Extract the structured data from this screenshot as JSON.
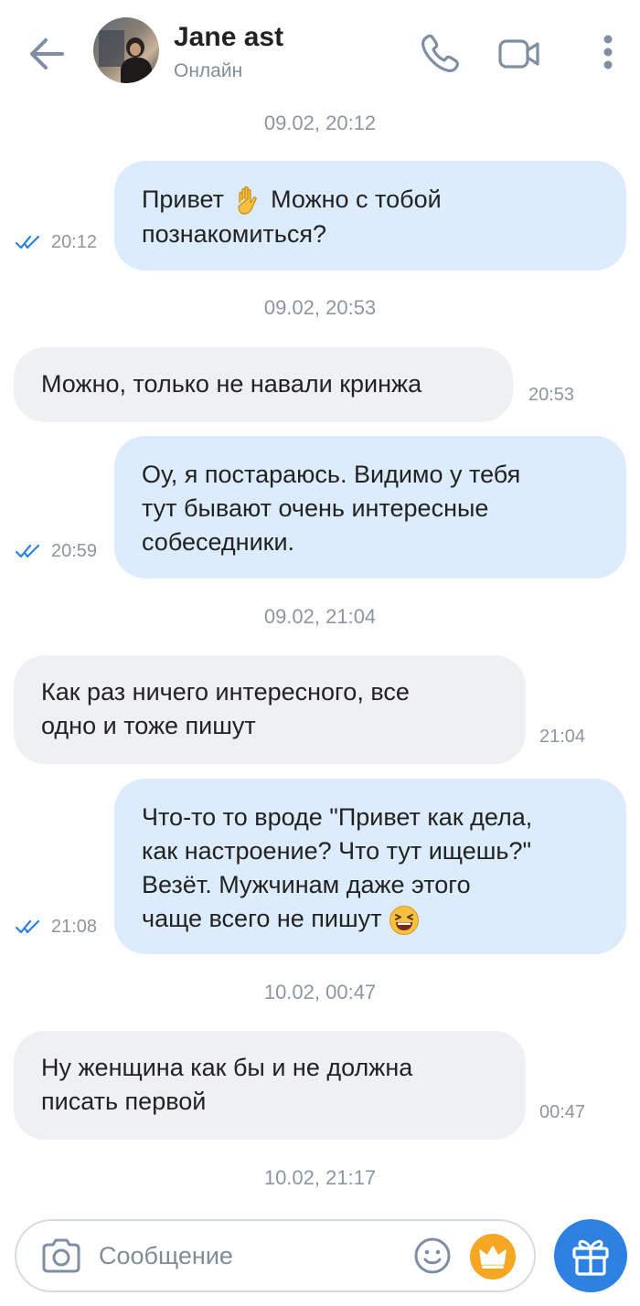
{
  "header": {
    "back_icon": "arrow-left-icon",
    "contact_name": "Jane ast",
    "status": "Онлайн",
    "call_icon": "phone-icon",
    "video_icon": "video-camera-icon",
    "menu_icon": "more-vertical-icon"
  },
  "dates": [
    "09.02, 20:12",
    "09.02, 20:53",
    "09.02, 21:04",
    "10.02, 00:47",
    "10.02, 21:17"
  ],
  "messages": [
    {
      "direction": "out",
      "text": "Привет",
      "text_after_emoji": "Можно с тобой",
      "text_line2": "познакомиться?",
      "emoji": "raised-hand",
      "time": "20:12",
      "read": true
    },
    {
      "direction": "in",
      "text": "Можно, только не навали кринжа",
      "time": "20:53"
    },
    {
      "direction": "out",
      "text": "Оу, я постараюсь. Видимо у тебя\nтут бывают очень интересные\nсобеседники.",
      "time": "20:59",
      "read": true
    },
    {
      "direction": "in",
      "text": "Как раз ничего интересного, все\nодно и тоже пишут",
      "time": "21:04"
    },
    {
      "direction": "out",
      "text": "Что-то то вроде \"Привет как дела,\nкак настроение? Что тут ищешь?\"\nВезёт. Мужчинам даже этого\nчаще всего не пишут",
      "emoji": "laughing-face",
      "time": "21:08",
      "read": true
    },
    {
      "direction": "in",
      "text": "Ну женщина как бы и не должна\nписать первой",
      "time": "00:47"
    }
  ],
  "composer": {
    "placeholder": "Сообщение",
    "camera_icon": "camera-icon",
    "smile_icon": "smile-icon",
    "crown_icon": "crown-icon",
    "gift_icon": "gift-icon"
  },
  "colors": {
    "outgoing_bubble": "#dcecfd",
    "incoming_bubble": "#eef0f3",
    "accent": "#2d81e0",
    "crown": "#f5a623",
    "muted_text": "#8c96a3"
  }
}
